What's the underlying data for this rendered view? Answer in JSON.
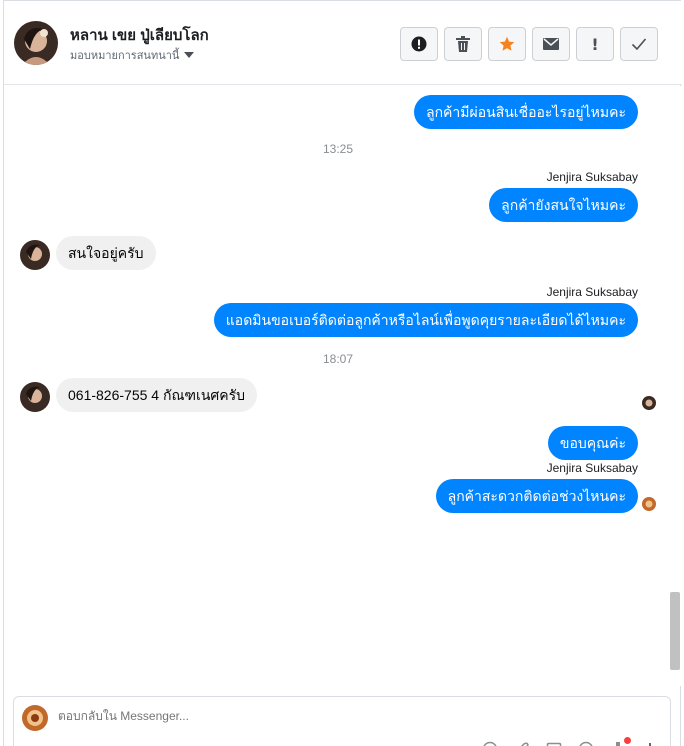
{
  "header": {
    "contact_name": "หลาน เขย ปู่เลียบโลก",
    "assign_label": "มอบหมายการสนทนานี้"
  },
  "actions": [
    {
      "name": "spam",
      "icon": "alert-circle-icon"
    },
    {
      "name": "delete",
      "icon": "trash-icon"
    },
    {
      "name": "star",
      "icon": "star-icon"
    },
    {
      "name": "mark-unread",
      "icon": "envelope-icon"
    },
    {
      "name": "important",
      "icon": "exclamation-icon",
      "glyph": "!"
    },
    {
      "name": "done",
      "icon": "checkmark-icon"
    }
  ],
  "conversation": {
    "msg1": "ลูกค้ามีผ่อนสินเชื่ออะไรอยู่ไหมคะ",
    "time1": "13:25",
    "sender1": "Jenjira Suksabay",
    "msg2": "ลูกค้ายังสนใจไหมคะ",
    "msg3": "สนใจอยู่ครับ",
    "sender2": "Jenjira Suksabay",
    "msg4": "แอดมินขอเบอร์ติดต่อลูกค้าหรือไลน์เพื่อพูดคุยรายละเอียดได้ไหมคะ",
    "time2": "18:07",
    "msg5": "061-826-755 4 กัณฑเนศครับ",
    "msg6": "ขอบคุณค่ะ",
    "sender3": "Jenjira Suksabay",
    "msg7": "ลูกค้าสะดวกติดต่อช่วงไหนคะ"
  },
  "composer": {
    "placeholder": "ตอบกลับใน Messenger..."
  },
  "colors": {
    "outgoing_bubble": "#0084ff",
    "incoming_bubble": "#f0f0f0",
    "star": "#f5821f"
  }
}
